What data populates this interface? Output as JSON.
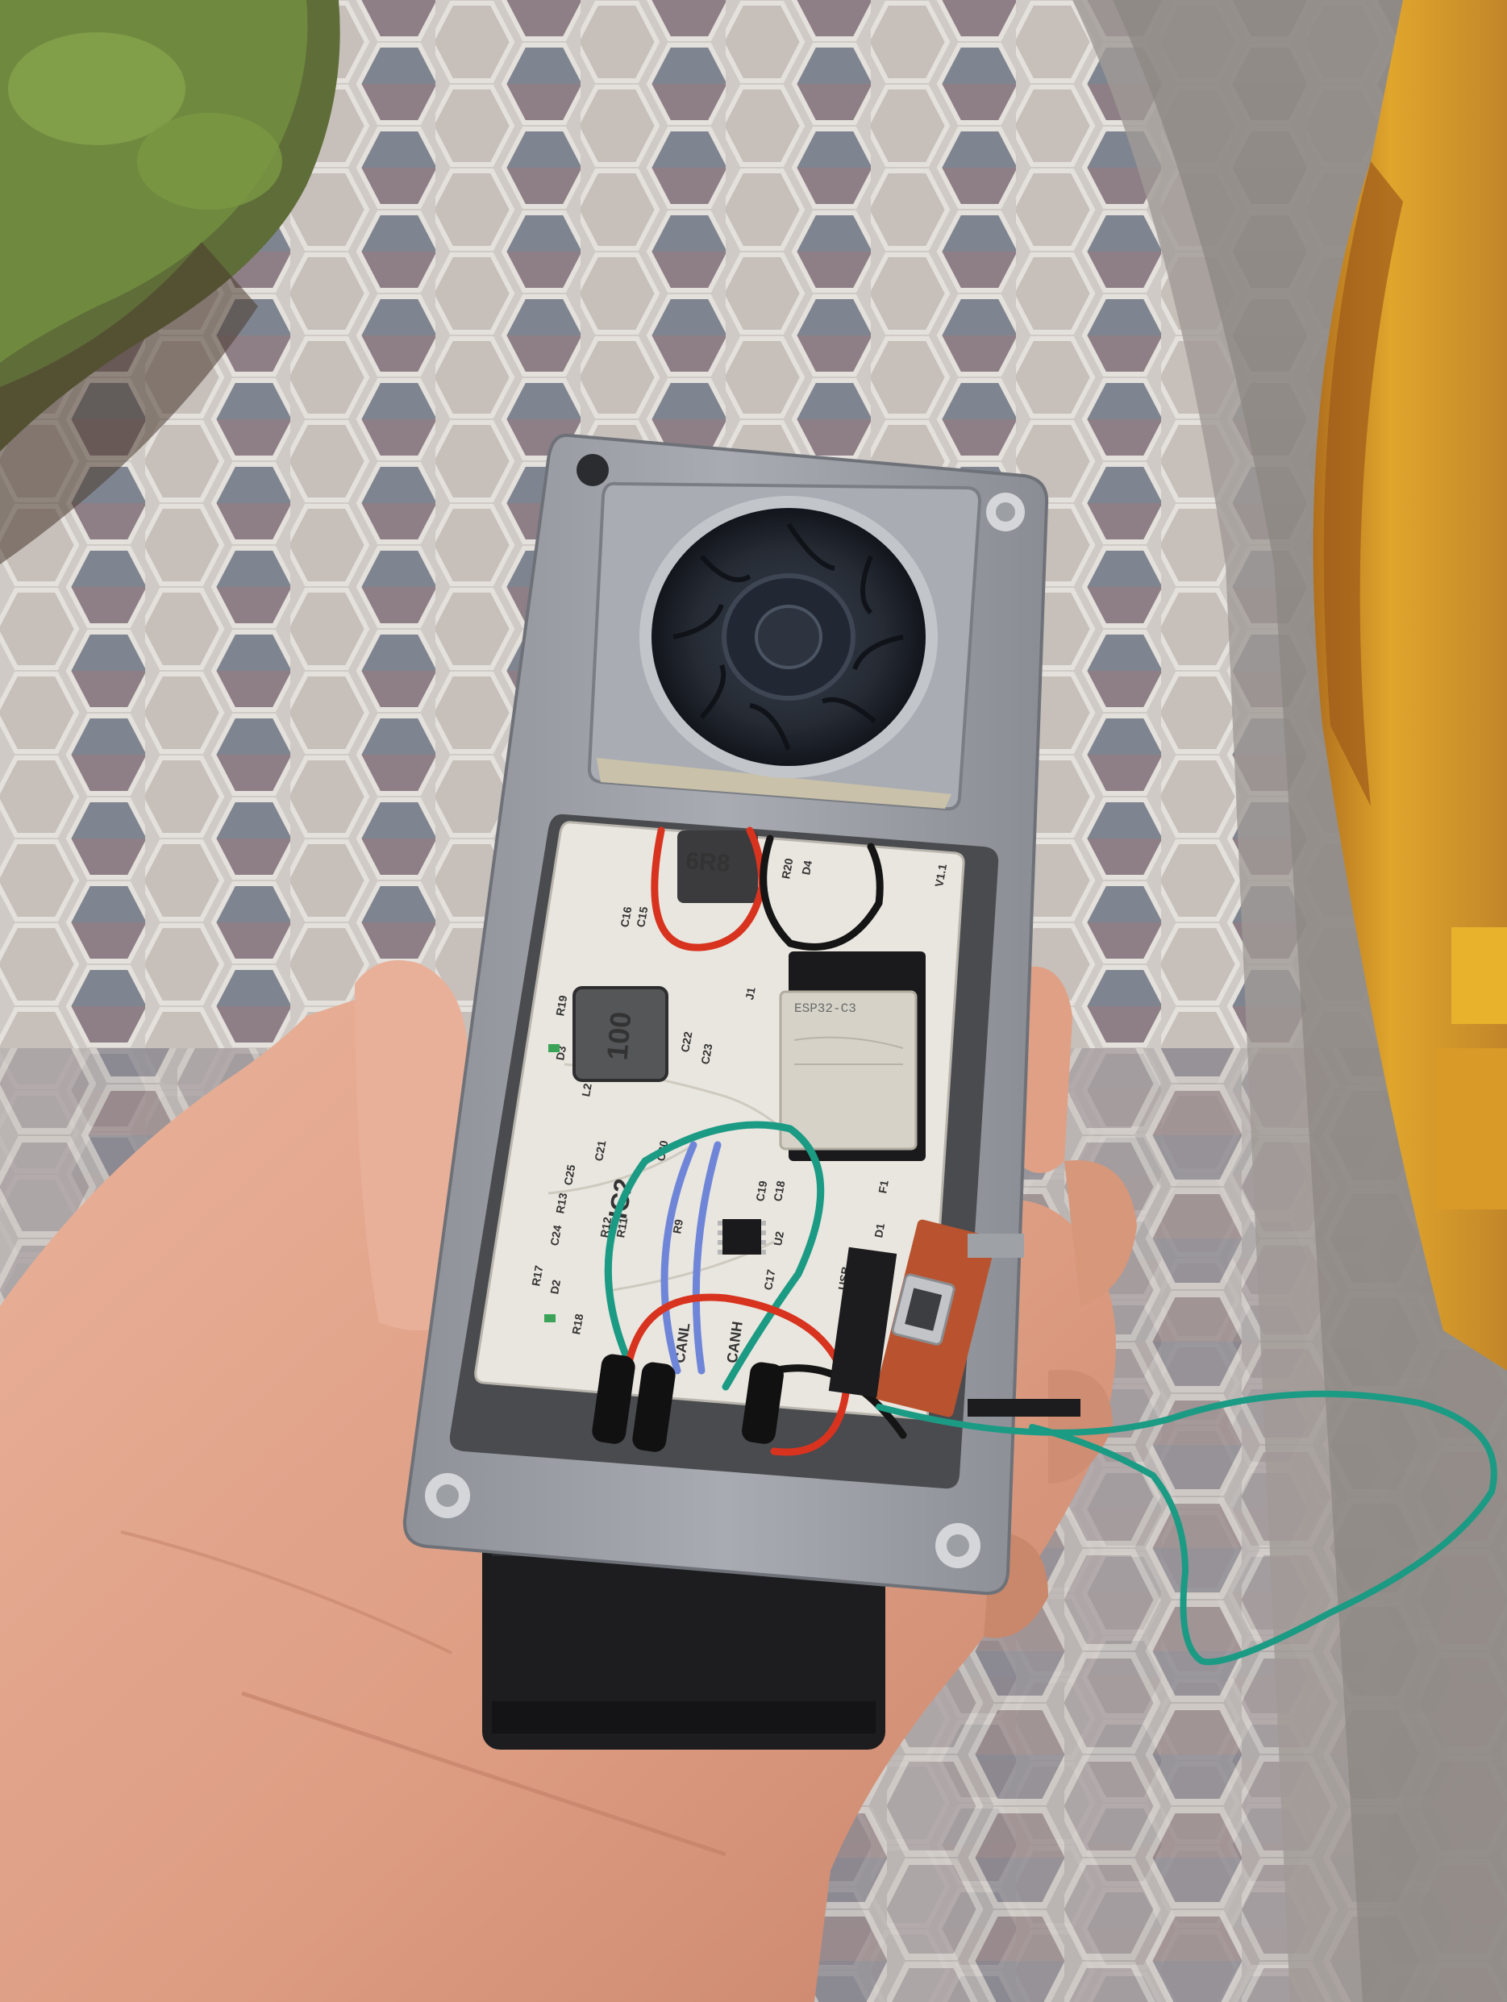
{
  "scene": {
    "colors": {
      "pavement_light": "#cfcac6",
      "pavement_tile_dark": "#8e7f86",
      "pavement_tile_blue": "#7f8590",
      "grass": "#6f8a3f",
      "enclosure": "#9da1a7",
      "pcb": "#e9e6df",
      "skin": "#e2a98f",
      "connector": "#1d1d1f",
      "wood": "#d59a2a",
      "wire_green": "#1b9a84",
      "wire_red": "#d8331f",
      "wire_blue": "#6f86d8",
      "wire_black": "#151515"
    }
  },
  "pcb_labels": {
    "inductor_top": "6R8",
    "inductor_main": "100",
    "module_brand": "ESP32-C3 ",
    "ic2": "IC2",
    "can_h": "CANH",
    "can_l": "CANL",
    "silkscreen": [
      "C16",
      "C15",
      "R20",
      "D4",
      "J1",
      "C22",
      "C23",
      "L2",
      "R19",
      "D3",
      "R13",
      "C25",
      "C24",
      "R12",
      "R11",
      "R9",
      "C21",
      "C20",
      "C18",
      "C19",
      "U2",
      "C17",
      "R17",
      "D2",
      "R18",
      "D1",
      "F1",
      "USB",
      "V1.1"
    ]
  }
}
